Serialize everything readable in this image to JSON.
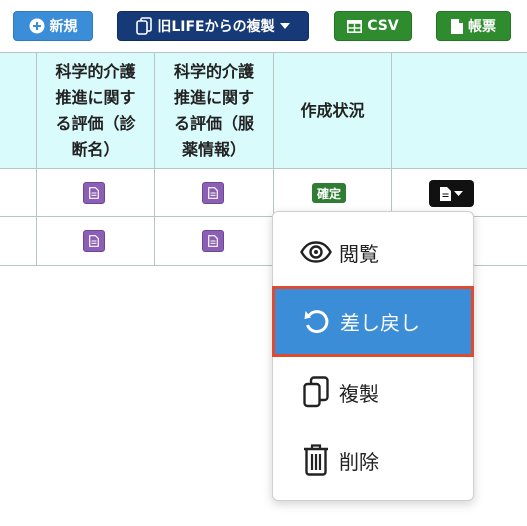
{
  "toolbar": {
    "new_label": "新規",
    "copy_legacy_label": "旧LIFEからの複製",
    "csv_label": "CSV",
    "forms_label": "帳票"
  },
  "table": {
    "headers": [
      "",
      "科学的介護推進に関する評価（診断名）",
      "科学的介護推進に関する評価（服薬情報）",
      "作成状況",
      ""
    ],
    "header_lines": {
      "col1": [
        "科学的介護",
        "推進に関す",
        "る評価（診",
        "断名）"
      ],
      "col2": [
        "科学的介護",
        "推進に関す",
        "る評価（服",
        "薬情報）"
      ],
      "col3": [
        "作成状況"
      ]
    },
    "rows": [
      {
        "status": "確定"
      },
      {
        "status": ""
      }
    ]
  },
  "dropdown": {
    "items": [
      {
        "label": "閲覧",
        "icon": "eye-icon"
      },
      {
        "label": "差し戻し",
        "icon": "undo-icon",
        "active": true
      },
      {
        "label": "複製",
        "icon": "copy-icon"
      },
      {
        "label": "削除",
        "icon": "trash-icon"
      }
    ]
  },
  "colors": {
    "primary": "#3c8dd8",
    "navy": "#163a78",
    "green": "#2e8b2e",
    "header_bg": "#d9fbfc",
    "doc_purple": "#8b5fb5",
    "highlight_border": "#e04a2f"
  }
}
